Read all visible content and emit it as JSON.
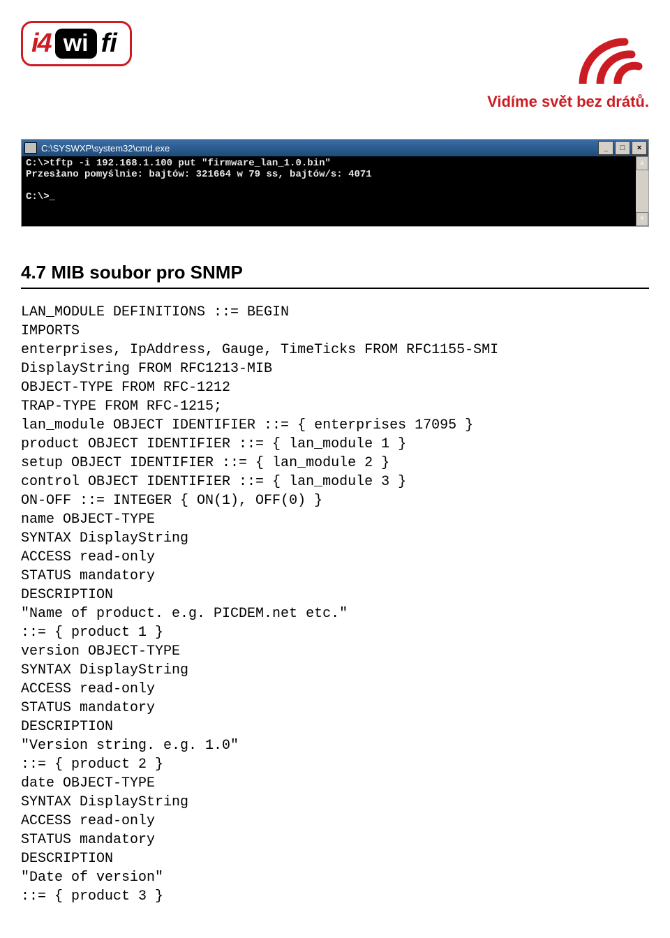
{
  "header": {
    "logo_i4": "i4",
    "logo_wi": "wi",
    "logo_fi": "fi",
    "tagline": "Vidíme svět bez drátů."
  },
  "console": {
    "title": "C:\\SYSWXP\\system32\\cmd.exe",
    "lines": [
      "C:\\>tftp -i 192.168.1.100 put \"firmware_lan_1.0.bin\"",
      "Przesłano pomyślnie: bajtów: 321664 w 79 ss, bajtów/s: 4071",
      "",
      "C:\\>_"
    ]
  },
  "section_title": "4.7 MIB soubor pro SNMP",
  "code_lines": [
    "LAN_MODULE DEFINITIONS ::= BEGIN",
    "IMPORTS",
    "enterprises, IpAddress, Gauge, TimeTicks FROM RFC1155-SMI",
    "DisplayString FROM RFC1213-MIB",
    "OBJECT-TYPE FROM RFC-1212",
    "TRAP-TYPE FROM RFC-1215;",
    "lan_module OBJECT IDENTIFIER ::= { enterprises 17095 }",
    "product OBJECT IDENTIFIER ::= { lan_module 1 }",
    "setup OBJECT IDENTIFIER ::= { lan_module 2 }",
    "control OBJECT IDENTIFIER ::= { lan_module 3 }",
    "ON-OFF ::= INTEGER { ON(1), OFF(0) }",
    "name OBJECT-TYPE",
    "SYNTAX DisplayString",
    "ACCESS read-only",
    "STATUS mandatory",
    "DESCRIPTION",
    "\"Name of product. e.g. PICDEM.net etc.\"",
    "::= { product 1 }",
    "version OBJECT-TYPE",
    "SYNTAX DisplayString",
    "ACCESS read-only",
    "STATUS mandatory",
    "DESCRIPTION",
    "\"Version string. e.g. 1.0\"",
    "::= { product 2 }",
    "date OBJECT-TYPE",
    "SYNTAX DisplayString",
    "ACCESS read-only",
    "STATUS mandatory",
    "DESCRIPTION",
    "\"Date of version\"",
    "::= { product 3 }"
  ]
}
